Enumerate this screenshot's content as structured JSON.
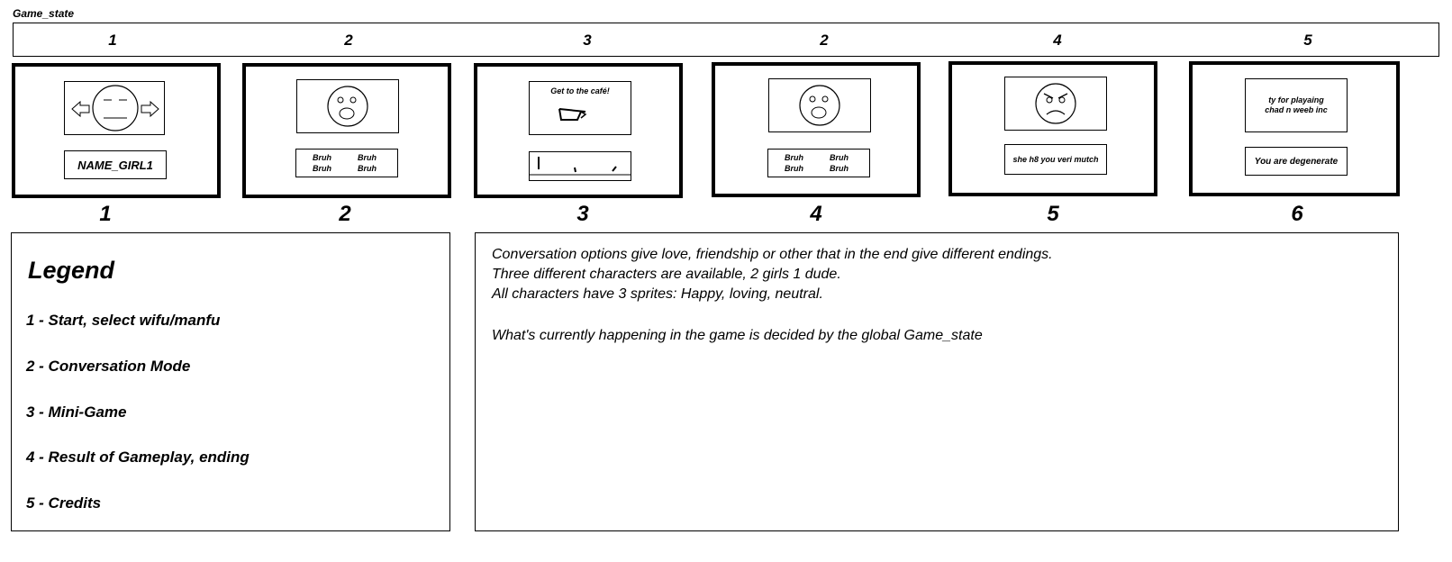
{
  "diagram": {
    "title": "Game_state",
    "state_numbers": [
      "1",
      "2",
      "3",
      "2",
      "4",
      "5"
    ],
    "screen_numbers": [
      "1",
      "2",
      "3",
      "4",
      "5",
      "6"
    ],
    "screens": {
      "s1": {
        "name_label": "NAME_GIRL1"
      },
      "s2": {
        "options": [
          "Bruh",
          "Bruh",
          "Bruh",
          "Bruh"
        ]
      },
      "s3": {
        "caption": "Get to the café!"
      },
      "s4": {
        "options": [
          "Bruh",
          "Bruh",
          "Bruh",
          "Bruh"
        ]
      },
      "s5": {
        "message": "she h8 you veri mutch"
      },
      "s6": {
        "credits": "ty for playaing\nchad n weeb inc",
        "message": "You are degenerate"
      }
    }
  },
  "legend": {
    "title": "Legend",
    "items": [
      "1 - Start, select wifu/manfu",
      "2 - Conversation Mode",
      "3 - Mini-Game",
      "4 - Result of Gameplay, ending",
      "5 - Credits"
    ]
  },
  "notes": {
    "lines": [
      "Conversation options give love, friendship or other that in the end give different endings.",
      "Three different characters are available, 2 girls 1 dude.",
      "All characters have 3 sprites: Happy, loving, neutral.",
      "",
      "What's currently happening in the game is decided by the global Game_state"
    ]
  }
}
